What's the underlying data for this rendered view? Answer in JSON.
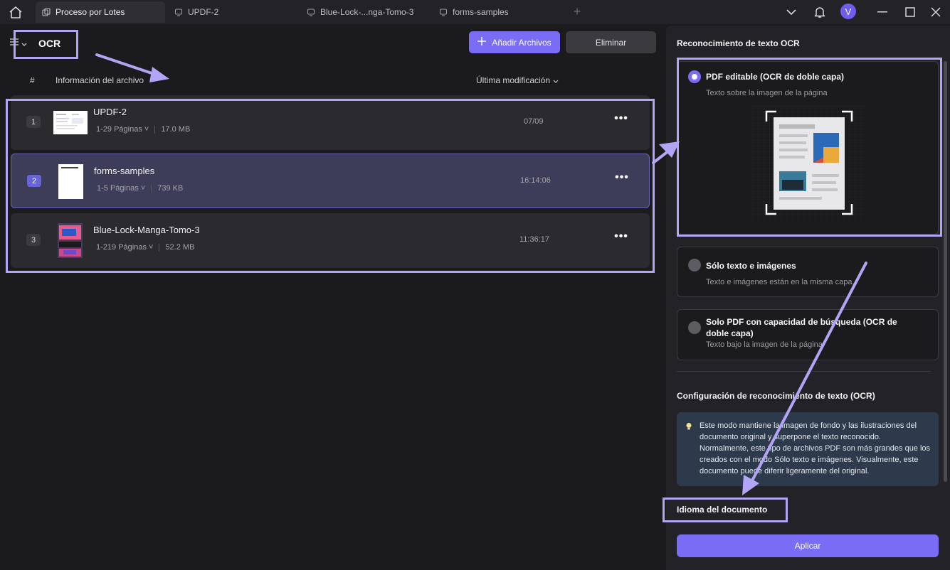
{
  "titlebar": {
    "tabs": [
      {
        "label": "Proceso por Lotes",
        "active": true
      },
      {
        "label": "UPDF-2",
        "active": false
      },
      {
        "label": "Blue-Lock-...nga-Tomo-3",
        "active": false
      },
      {
        "label": "forms-samples",
        "active": false
      }
    ],
    "avatar_letter": "V"
  },
  "left": {
    "title": "OCR",
    "add_files_label": "Añadir Archivos",
    "delete_label": "Eliminar",
    "columns": {
      "hash": "#",
      "info": "Información del archivo",
      "modified": "Última modificación"
    },
    "files": [
      {
        "num": "1",
        "name": "UPDF-2",
        "pages": "1-29 Páginas",
        "size": "17.0 MB",
        "date": "07/09",
        "selected": false
      },
      {
        "num": "2",
        "name": "forms-samples",
        "pages": "1-5 Páginas",
        "size": "739 KB",
        "date": "16:14:06",
        "selected": true
      },
      {
        "num": "3",
        "name": "Blue-Lock-Manga-Tomo-3",
        "pages": "1-219 Páginas",
        "size": "52.2 MB",
        "date": "11:36:17",
        "selected": false
      }
    ]
  },
  "right": {
    "ocr_title": "Reconocimiento de texto OCR",
    "options": [
      {
        "label": "PDF editable (OCR de doble capa)",
        "desc": "Texto sobre la imagen de la página",
        "selected": true
      },
      {
        "label": "Sólo texto e imágenes",
        "desc": "Texto e imágenes están en la misma capa.",
        "selected": false
      },
      {
        "label": "Solo PDF con capacidad de búsqueda (OCR de doble capa)",
        "desc": "Texto bajo la imagen de la página",
        "selected": false
      }
    ],
    "config_title": "Configuración de reconocimiento de texto (OCR)",
    "info_text": "Este modo mantiene la imagen de fondo y las ilustraciones del documento original y superpone el texto reconocido. Normalmente, este tipo de archivos PDF son más grandes que los creados con el modo Sólo texto e imágenes. Visualmente, este documento puede diferir ligeramente del original.",
    "language_title": "Idioma del documento",
    "apply_label": "Aplicar"
  },
  "colors": {
    "accent": "#7a6cf5",
    "annotation": "#b3a5f5",
    "panel_bg": "#232327",
    "row_bg": "#2a2a2f",
    "selected_row_bg": "#3d3d5a"
  }
}
